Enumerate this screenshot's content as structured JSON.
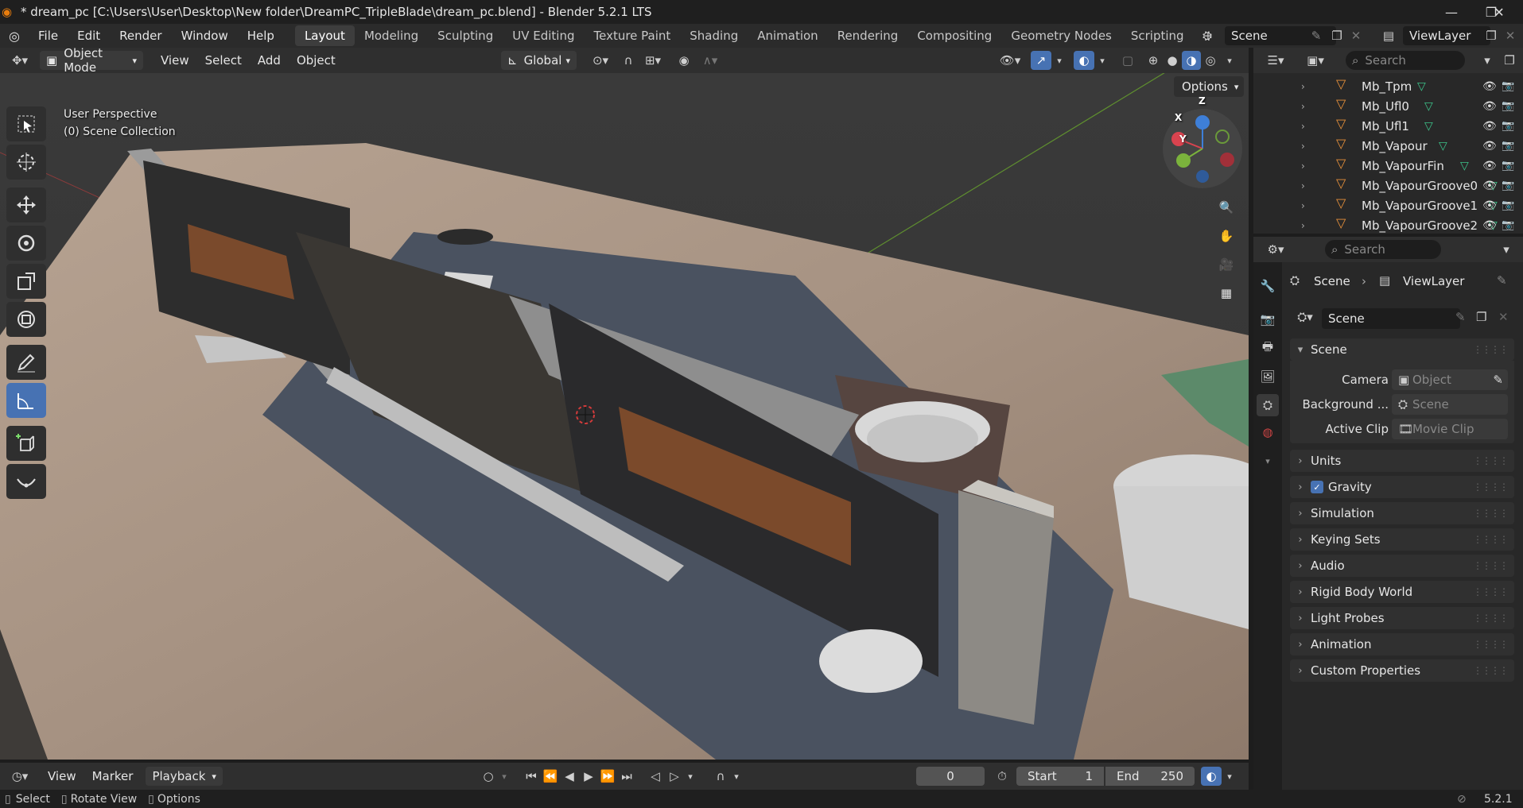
{
  "window": {
    "title": "* dream_pc [C:\\Users\\User\\Desktop\\New folder\\DreamPC_TripleBlade\\dream_pc.blend] - Blender 5.2.1 LTS",
    "minimize": "—",
    "maximize": "❐",
    "close": "✕"
  },
  "menubar": {
    "menus": [
      "File",
      "Edit",
      "Render",
      "Window",
      "Help"
    ],
    "workspaces": [
      "Layout",
      "Modeling",
      "Sculpting",
      "UV Editing",
      "Texture Paint",
      "Shading",
      "Animation",
      "Rendering",
      "Compositing",
      "Geometry Nodes",
      "Scripting"
    ],
    "active_workspace": "Layout",
    "add_tab": "+",
    "scene_name": "Scene",
    "view_layer_name": "ViewLayer"
  },
  "viewport_header": {
    "mode": "Object Mode",
    "menus": [
      "View",
      "Select",
      "Add",
      "Object"
    ],
    "transform_orientation": "Global",
    "options_label": "Options"
  },
  "viewport": {
    "perspective_label": "User Perspective",
    "collection_label": "(0) Scene Collection",
    "gizmo": {
      "x": "X",
      "y": "Y",
      "z": "Z"
    },
    "colors": {
      "x_axis": "#d9434f",
      "y_axis": "#7bb33c",
      "z_axis": "#3e7fd8"
    }
  },
  "toolbar": {
    "tools": [
      "select-box",
      "cursor",
      "move",
      "rotate",
      "scale",
      "transform",
      "annotate",
      "measure",
      "add-cube",
      "extrude-curve"
    ],
    "active_tool": "measure"
  },
  "outliner": {
    "search_placeholder": "Search",
    "items": [
      "Mb_Tpm",
      "Mb_Ufl0",
      "Mb_Ufl1",
      "Mb_Vapour",
      "Mb_VapourFin",
      "Mb_VapourGroove0",
      "Mb_VapourGroove1",
      "Mb_VapourGroove2"
    ]
  },
  "properties": {
    "search_placeholder": "Search",
    "breadcrumb": [
      "Scene",
      "ViewLayer"
    ],
    "scene_datablock": "Scene",
    "scene_panel": {
      "title": "Scene",
      "rows": [
        {
          "label": "Camera",
          "placeholder": "Object"
        },
        {
          "label": "Background ...",
          "placeholder": "Scene"
        },
        {
          "label": "Active Clip",
          "placeholder": "Movie Clip"
        }
      ]
    },
    "panels": [
      "Units",
      "Gravity",
      "Simulation",
      "Keying Sets",
      "Audio",
      "Rigid Body World",
      "Light Probes",
      "Animation",
      "Custom Properties"
    ],
    "gravity_enabled": true
  },
  "timeline": {
    "menus": [
      "View",
      "Marker"
    ],
    "playback": "Playback",
    "current_frame": "0",
    "start_label": "Start",
    "start_value": "1",
    "end_label": "End",
    "end_value": "250"
  },
  "statusbar": {
    "select": "Select",
    "rotate_view": "Rotate View",
    "options": "Options",
    "version": "5.2.1"
  }
}
